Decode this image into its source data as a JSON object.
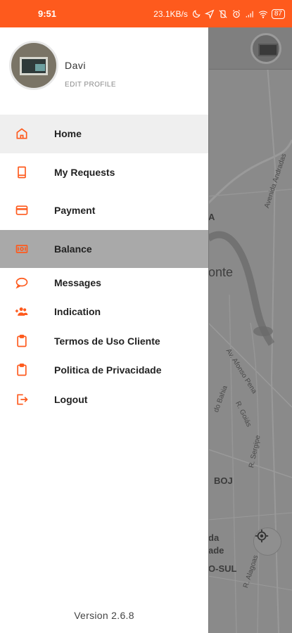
{
  "status_bar": {
    "time": "9:51",
    "speed": "23.1KB/s",
    "battery": "87"
  },
  "profile": {
    "name": "Davi",
    "edit_label": "EDIT PROFILE"
  },
  "menu": {
    "items": [
      {
        "label": "Home",
        "icon": "home-icon"
      },
      {
        "label": "My Requests",
        "icon": "bookmark-icon"
      },
      {
        "label": "Payment",
        "icon": "credit-card-icon"
      },
      {
        "label": "Balance",
        "icon": "cash-icon"
      },
      {
        "label": "Messages",
        "icon": "chat-bubble-icon"
      },
      {
        "label": "Indication",
        "icon": "add-group-icon"
      },
      {
        "label": "Termos de Uso Cliente",
        "icon": "clipboard-icon"
      },
      {
        "label": "Politica de Privacidade",
        "icon": "clipboard-icon"
      },
      {
        "label": "Logout",
        "icon": "logout-icon"
      }
    ]
  },
  "version": "Version 2.6.8",
  "map": {
    "labels": [
      "A",
      "onte",
      "BOJ",
      "da",
      "ade",
      "O-SUL"
    ],
    "streets": [
      "Av. Afonso Pena",
      "Avenida Andradas",
      "do Bahia",
      "R. Goiás",
      "R. Sergipe",
      "R. Alagoas"
    ]
  },
  "colors": {
    "accent": "#fe5a1d",
    "home_highlight": "#efefef",
    "balance_highlight": "#a9a9a9",
    "map_dim": "#8a8a8a"
  }
}
